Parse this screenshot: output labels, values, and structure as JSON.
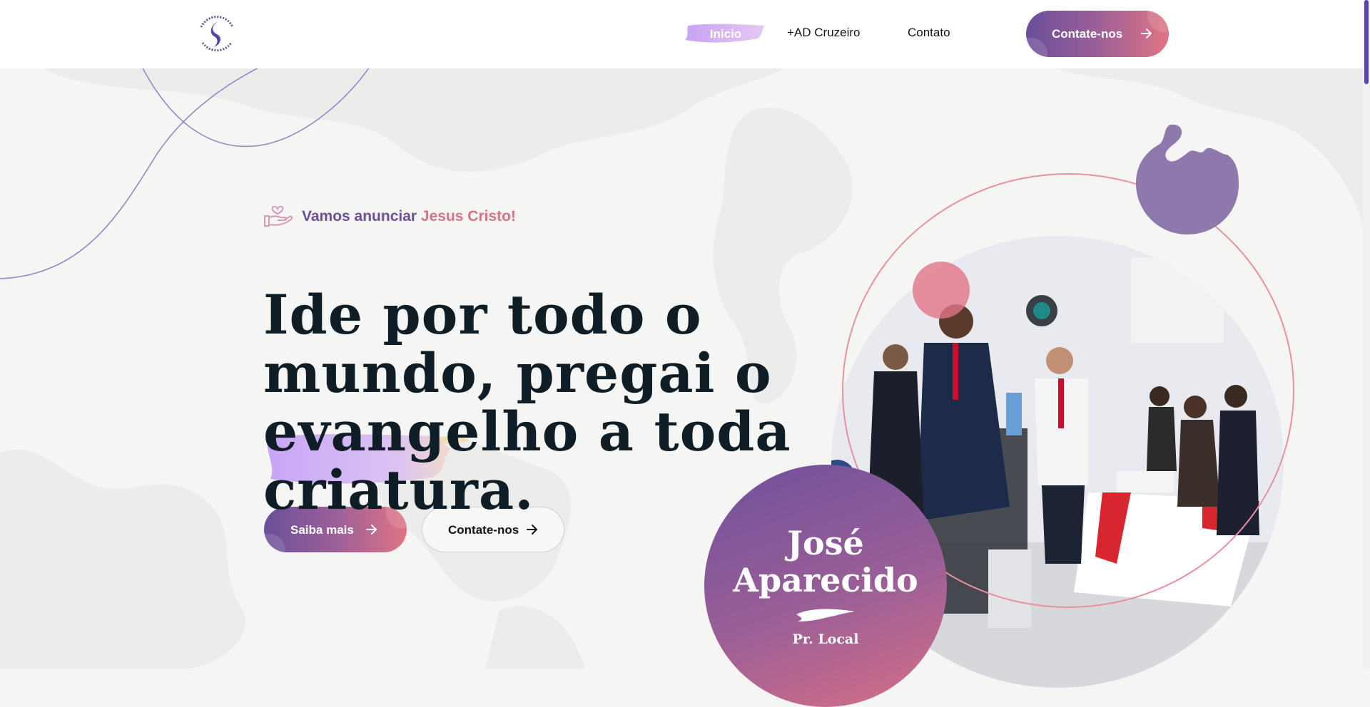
{
  "header": {
    "logo_icon": "church-logo-icon",
    "nav": [
      {
        "label": "Inicio",
        "active": true
      },
      {
        "label": "+AD Cruzeiro"
      },
      {
        "label": "Contato"
      }
    ],
    "cta_label": "Contate-nos",
    "cta_icon": "arrow-right-icon"
  },
  "hero": {
    "tagline_icon": "hand-heart-icon",
    "tagline_part1": "Vamos anunciar ",
    "tagline_part2": "Jesus Cristo!",
    "headline_lines": [
      "Ide por todo o",
      "mundo, pregai o",
      "evangelho a toda",
      "criatura."
    ],
    "primary_button": "Saiba mais",
    "secondary_button": "Contate-nos"
  },
  "pastor": {
    "name_line1": "José",
    "name_line2": "Aparecido",
    "role": "Pr. Local"
  },
  "colors": {
    "brand_purple": "#6a4f9b",
    "brand_pink": "#e07484",
    "heading": "#0f1e26",
    "highlight_brush": "#c9a8f5"
  }
}
